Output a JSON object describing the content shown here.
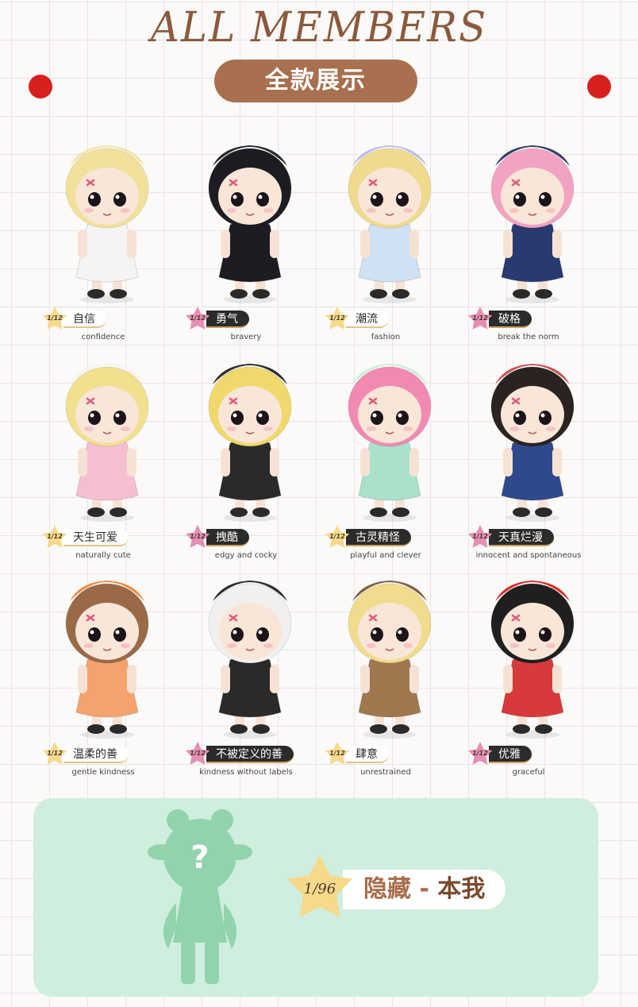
{
  "header": {
    "title": "ALL MEMBERS",
    "subtitle": "全款展示"
  },
  "colors": {
    "accent_brown": "#a8704e",
    "dot_red": "#d8201e",
    "panel_mint": "#cfeedd",
    "star_yellow": "#f6d98a",
    "star_pink": "#e58fb5"
  },
  "members": [
    {
      "ratio": "1/12",
      "name_cn": "自信",
      "name_en": "confidence",
      "star": "yellow",
      "style": "light",
      "hair": "#f1e19a",
      "outfit": "#f4f4f2",
      "hat": "#f1e19a"
    },
    {
      "ratio": "1/12",
      "name_cn": "勇气",
      "name_en": "bravery",
      "star": "pink",
      "style": "dark",
      "hair": "#1c1c22",
      "outfit": "#1c1c22",
      "hat": "#1c1c22"
    },
    {
      "ratio": "1/12",
      "name_cn": "潮流",
      "name_en": "fashion",
      "star": "yellow",
      "style": "light",
      "hair": "#f0da8e",
      "outfit": "#cfe1f2",
      "hat": "#b9b9e6"
    },
    {
      "ratio": "1/12",
      "name_cn": "破格",
      "name_en": "break the norm",
      "star": "pink",
      "style": "dark",
      "hair": "#f2a3c2",
      "outfit": "#2a3a70",
      "hat": "#2b3566"
    },
    {
      "ratio": "1/12",
      "name_cn": "天生可爱",
      "name_en": "naturally cute",
      "star": "yellow",
      "style": "light",
      "hair": "#f1e08e",
      "outfit": "#f6bfd1",
      "hat": "#f6f3f0"
    },
    {
      "ratio": "1/12",
      "name_cn": "拽酷",
      "name_en": "edgy and cocky",
      "star": "pink",
      "style": "dark",
      "hair": "#f0d86c",
      "outfit": "#2a2a2a",
      "hat": "#222222"
    },
    {
      "ratio": "1/12",
      "name_cn": "古灵精怪",
      "name_en": "playful and clever",
      "star": "yellow",
      "style": "dark",
      "hair": "#f08ab3",
      "outfit": "#a9e1cb",
      "hat": "#c8ecd8"
    },
    {
      "ratio": "1/12",
      "name_cn": "天真烂漫",
      "name_en": "innocent and spontaneous",
      "star": "pink",
      "style": "dark",
      "hair": "#2a2320",
      "outfit": "#2e4a8c",
      "hat": "#c94a4a"
    },
    {
      "ratio": "1/12",
      "name_cn": "温柔的善",
      "name_en": "gentle kindness",
      "star": "yellow",
      "style": "light",
      "hair": "#9a6a48",
      "outfit": "#f5a36e",
      "hat": "#e8873e"
    },
    {
      "ratio": "1/12",
      "name_cn": "不被定义的善",
      "name_en": "kindness without labels",
      "star": "pink",
      "style": "dark",
      "hair": "#f2f0ee",
      "outfit": "#2a2a2a",
      "hat": "#222222"
    },
    {
      "ratio": "1/12",
      "name_cn": "肆意",
      "name_en": "unrestrained",
      "star": "yellow",
      "style": "light",
      "hair": "#f0dc8c",
      "outfit": "#a07850",
      "hat": "#7a5236"
    },
    {
      "ratio": "1/12",
      "name_cn": "优雅",
      "name_en": "graceful",
      "star": "pink",
      "style": "dark",
      "hair": "#1f1f1f",
      "outfit": "#d63a3a",
      "hat": "#d8201e"
    }
  ],
  "hidden": {
    "ratio": "1/96",
    "label_a": "隐藏 - ",
    "label_b": "本我",
    "silhouette_color": "#92d3ad"
  }
}
